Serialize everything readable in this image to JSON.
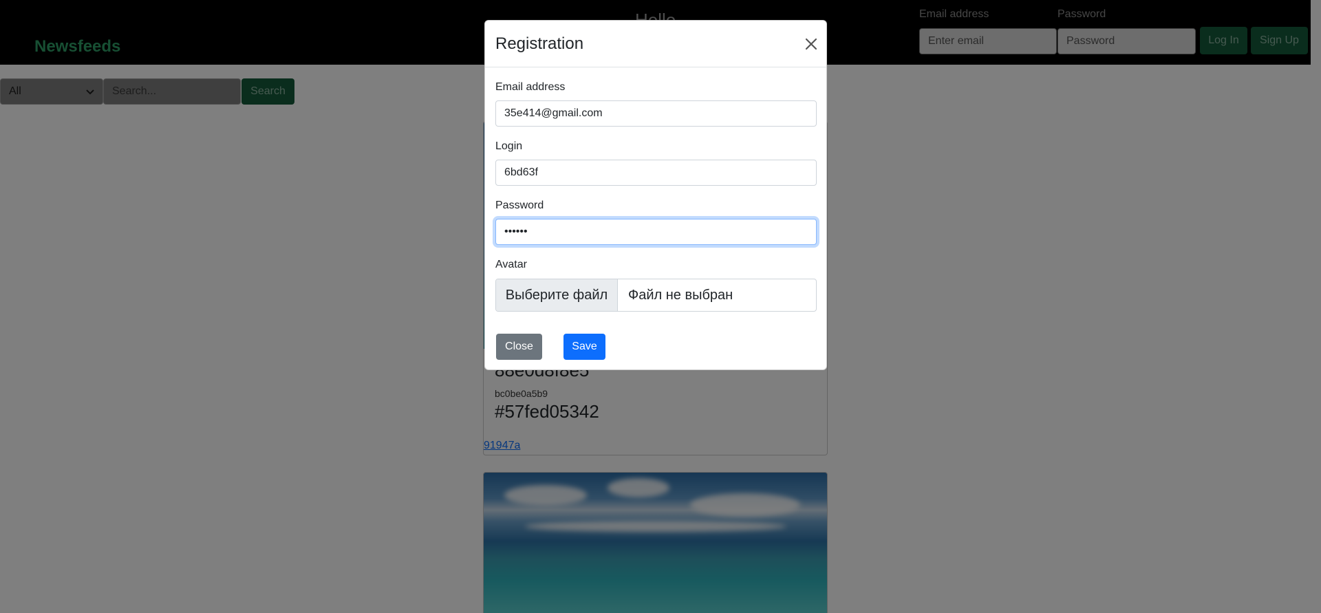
{
  "navbar": {
    "brand": "Newsfeeds",
    "greeting": "Hello",
    "email_label": "Email address",
    "email_placeholder": "Enter email",
    "password_label": "Password",
    "password_placeholder": "Password",
    "login_label": "Log In",
    "signup_label": "Sign Up"
  },
  "filter": {
    "category_selected": "All",
    "search_placeholder": "Search...",
    "search_button": "Search"
  },
  "posts": [
    {
      "title": "88e0d8f8e5",
      "author": "bc0be0a5b9",
      "tag": "#57fed05342",
      "link": "91947a"
    }
  ],
  "modal": {
    "title": "Registration",
    "email_label": "Email address",
    "email_value": "35e414@gmail.com",
    "login_label": "Login",
    "login_value": "6bd63f",
    "password_label": "Password",
    "password_value": "••••••",
    "avatar_label": "Avatar",
    "file_button": "Выберите файл",
    "file_status": "Файл не выбран",
    "close_button": "Close",
    "save_button": "Save"
  },
  "colors": {
    "brand": "#2e9e67",
    "primary": "#0d6efd",
    "secondary": "#6c757d",
    "success": "#198754"
  },
  "icons": {
    "close": "close-icon",
    "select": "chevron-down-icon"
  }
}
